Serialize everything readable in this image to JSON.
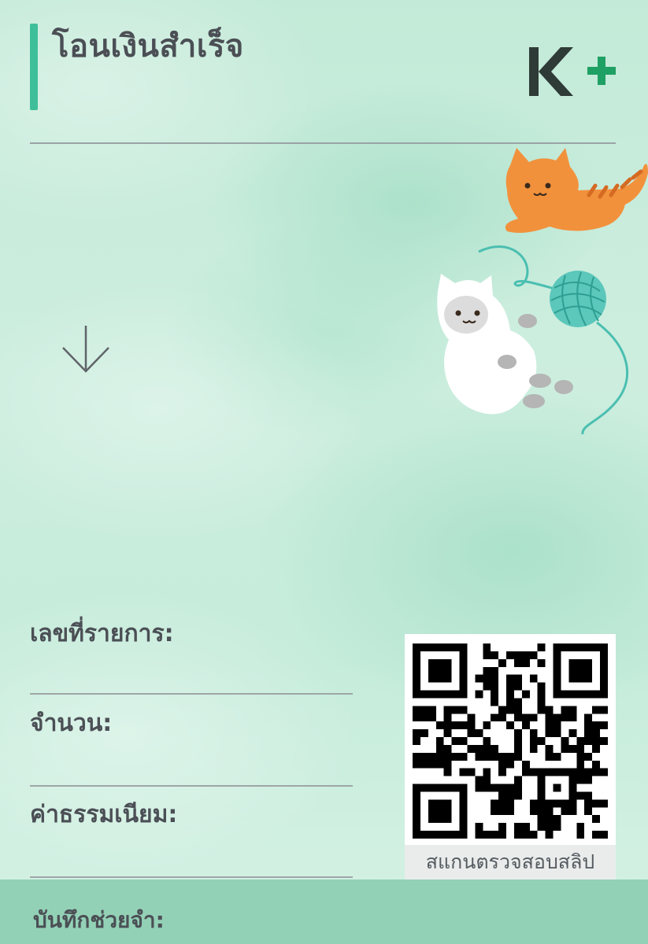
{
  "header": {
    "title": "โอนเงินสำเร็จ",
    "logo_text": "K+",
    "accent_color": "#3fbf99",
    "logo_k_color": "#2f3b37",
    "logo_plus_color": "#1fa064"
  },
  "illustration": {
    "description_icon": "cats-playing-with-yarn",
    "arrow_icon": "arrow-down-icon"
  },
  "details": {
    "transaction_no_label": "เลขที่รายการ:",
    "amount_label": "จำนวน:",
    "fee_label": "ค่าธรรมเนียม:"
  },
  "qr": {
    "icon": "qr-code",
    "caption": "สแกนตรวจสอบสลิป"
  },
  "footer": {
    "memo_label": "บันทึกช่วยจำ:",
    "background_color": "#93d1b6"
  }
}
